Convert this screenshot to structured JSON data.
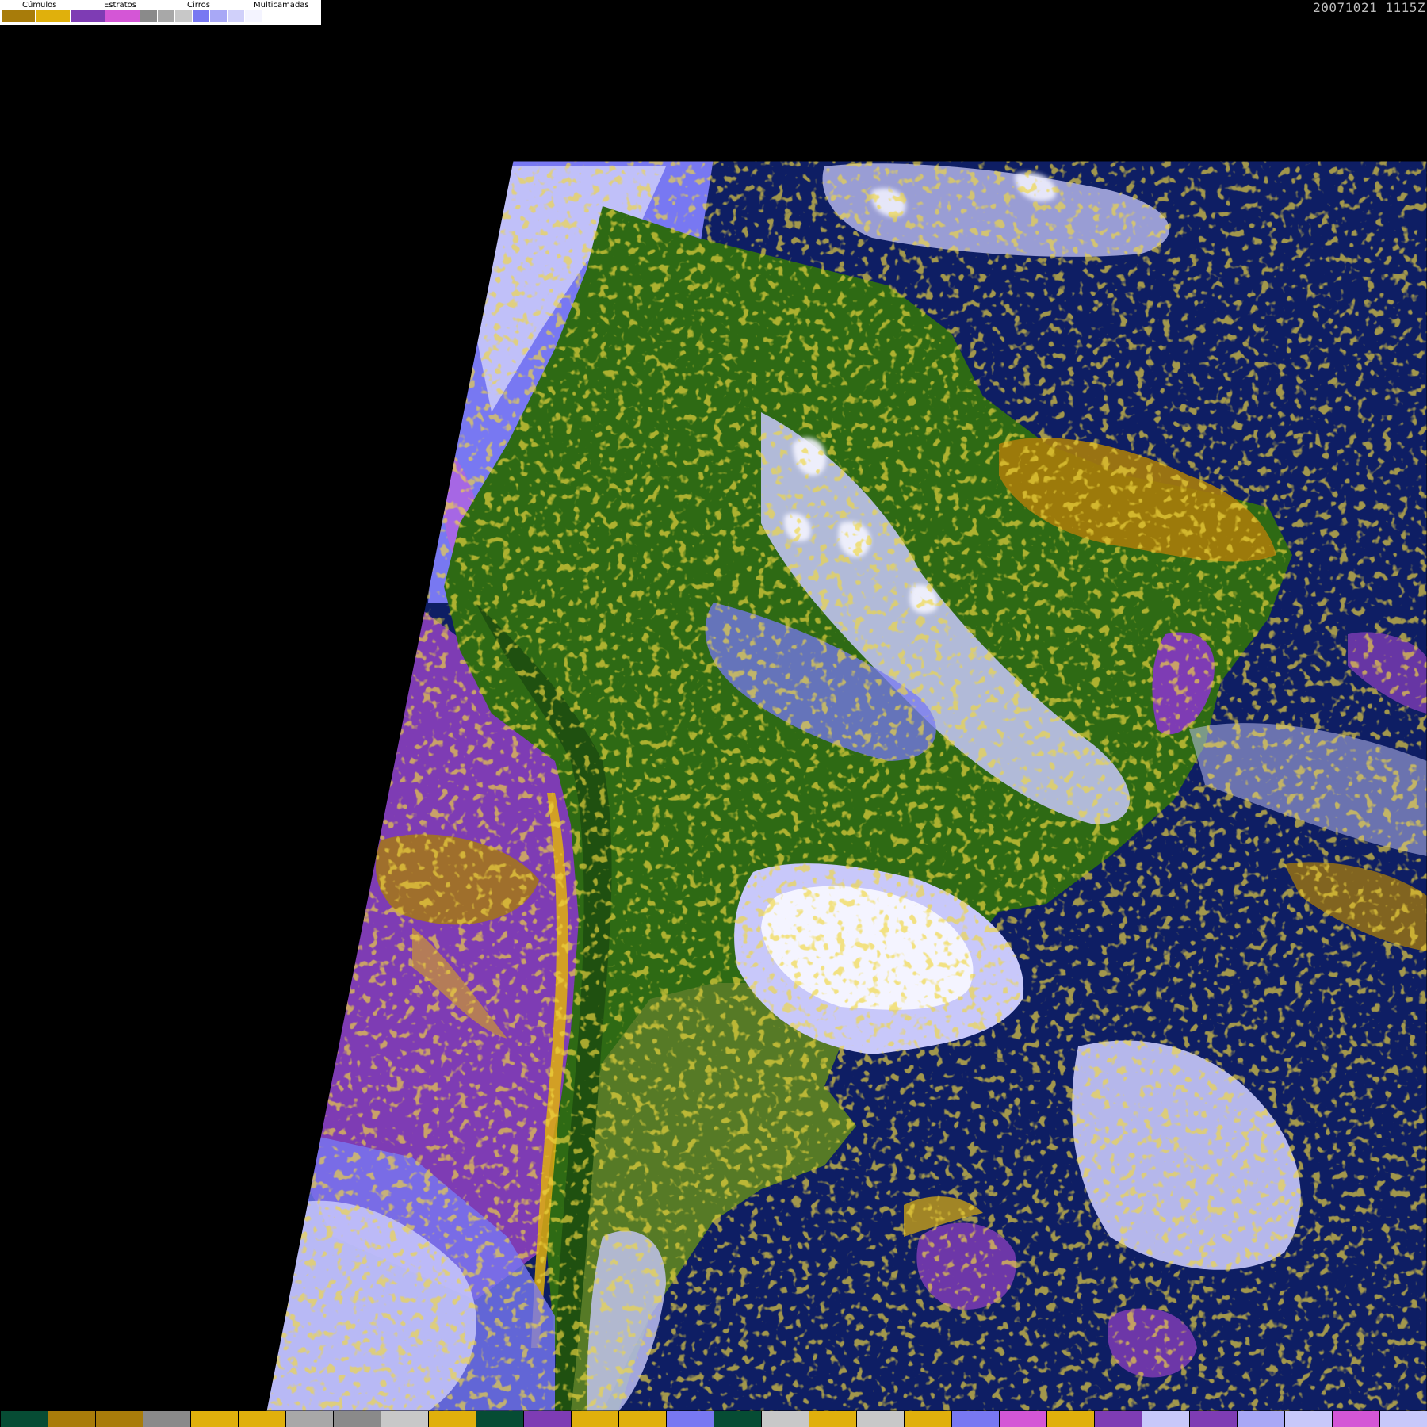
{
  "legend": {
    "labels": [
      "Cúmulos",
      "Estratos",
      "Cirros",
      "Multicamadas"
    ],
    "swatches": [
      "#a87c0a",
      "#e0b00c",
      "#7e3cb4",
      "#d456d6",
      "#8a8a8a",
      "#a8a8a8",
      "#c8c8c8",
      "#7878f2",
      "#a8a8f6",
      "#d0d0fa",
      "#f4f4ff"
    ]
  },
  "timestamp": "20071021 1115Z",
  "map_colors": {
    "background": "#000000",
    "ocean": "#0e1e64",
    "land_forest": "#2e6a14",
    "land_dark": "#1f5010",
    "land_olive": "#567a26",
    "stratus": "#7e3cb4",
    "stratus_light": "#d456d6",
    "cumulus_dark": "#a87c0a",
    "cumulus": "#e0b00c",
    "cirrus": "#a8a8a8",
    "multilayer_blue": "#7878f2",
    "multilayer_light": "#c8c8fa",
    "multilayer_white": "#f4f4ff"
  },
  "bottom_strip": [
    "#064c34",
    "#a87c0a",
    "#a87c0a",
    "#8a8a8a",
    "#e0b00c",
    "#e0b00c",
    "#a8a8a8",
    "#8a8a8a",
    "#c8c8c8",
    "#e0b00c",
    "#064c34",
    "#7e3cb4",
    "#e0b00c",
    "#e0b00c",
    "#7878f2",
    "#064c34",
    "#c8c8c8",
    "#e0b00c",
    "#c8c8c8",
    "#e0b00c",
    "#7878f2",
    "#d456d6",
    "#e0b00c",
    "#7e3cb4",
    "#c8c8fa",
    "#7e3cb4",
    "#a8a8f6",
    "#c8c8fa",
    "#d456d6",
    "#c8c8fa"
  ]
}
